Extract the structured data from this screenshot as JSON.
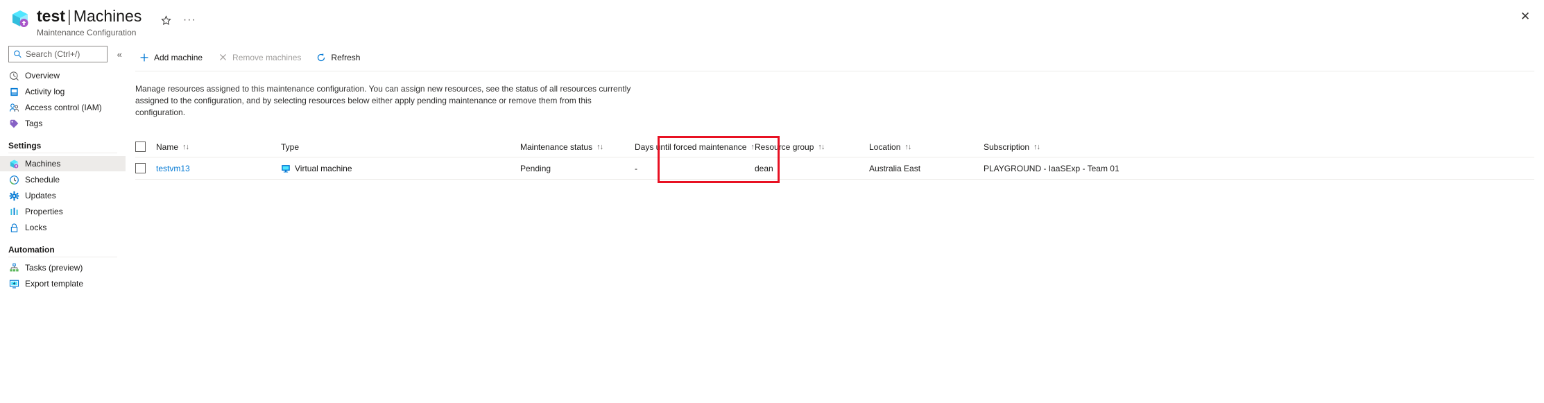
{
  "header": {
    "resource_icon": "maintenance-configuration-cube-icon",
    "title_resource": "test",
    "title_separator": "|",
    "title_section": "Machines",
    "subtitle": "Maintenance Configuration",
    "favorite_icon": "star-icon",
    "more_label": "···",
    "close_label": "✕"
  },
  "sidebar": {
    "search": {
      "placeholder": "Search (Ctrl+/)",
      "value": "",
      "icon": "search-icon"
    },
    "collapse_label": "«",
    "items": [
      {
        "label": "Overview",
        "icon": "overview-icon",
        "selected": false
      },
      {
        "label": "Activity log",
        "icon": "activity-log-icon",
        "selected": false
      },
      {
        "label": "Access control (IAM)",
        "icon": "access-control-icon",
        "selected": false
      },
      {
        "label": "Tags",
        "icon": "tags-icon",
        "selected": false
      }
    ],
    "groups": [
      {
        "title": "Settings",
        "items": [
          {
            "label": "Machines",
            "icon": "machines-icon",
            "selected": true
          },
          {
            "label": "Schedule",
            "icon": "schedule-clock-icon",
            "selected": false
          },
          {
            "label": "Updates",
            "icon": "updates-gear-icon",
            "selected": false
          },
          {
            "label": "Properties",
            "icon": "properties-icon",
            "selected": false
          },
          {
            "label": "Locks",
            "icon": "lock-icon",
            "selected": false
          }
        ]
      },
      {
        "title": "Automation",
        "items": [
          {
            "label": "Tasks (preview)",
            "icon": "tasks-icon",
            "selected": false
          },
          {
            "label": "Export template",
            "icon": "export-template-icon",
            "selected": false
          }
        ]
      }
    ]
  },
  "toolbar": {
    "add_machine": "Add machine",
    "add_icon": "plus-icon",
    "remove_machines": "Remove machines",
    "remove_icon": "cross-icon",
    "remove_disabled": true,
    "refresh": "Refresh",
    "refresh_icon": "refresh-icon"
  },
  "description": "Manage resources assigned to this maintenance configuration. You can assign new resources, see the status of all resources currently assigned to the configuration, and by selecting resources below either apply pending maintenance or remove them from this configuration.",
  "table": {
    "sort_glyph": "↑↓",
    "select_all_checked": false,
    "columns": [
      {
        "key": "name",
        "label": "Name",
        "sortable": true
      },
      {
        "key": "type",
        "label": "Type",
        "sortable": false
      },
      {
        "key": "status",
        "label": "Maintenance status",
        "sortable": true
      },
      {
        "key": "days",
        "label": "Days until forced maintenance",
        "sortable": true
      },
      {
        "key": "resource_group",
        "label": "Resource group",
        "sortable": true
      },
      {
        "key": "location",
        "label": "Location",
        "sortable": true
      },
      {
        "key": "subscription",
        "label": "Subscription",
        "sortable": true
      }
    ],
    "rows": [
      {
        "checked": false,
        "name": "testvm13",
        "type": "Virtual machine",
        "type_icon": "virtual-machine-icon",
        "status": "Pending",
        "days": "-",
        "resource_group": "dean",
        "location": "Australia East",
        "subscription": "PLAYGROUND - IaaSExp - Team 01"
      }
    ]
  },
  "annotation": {
    "color": "#e81123",
    "target": "maintenance-status-column"
  }
}
